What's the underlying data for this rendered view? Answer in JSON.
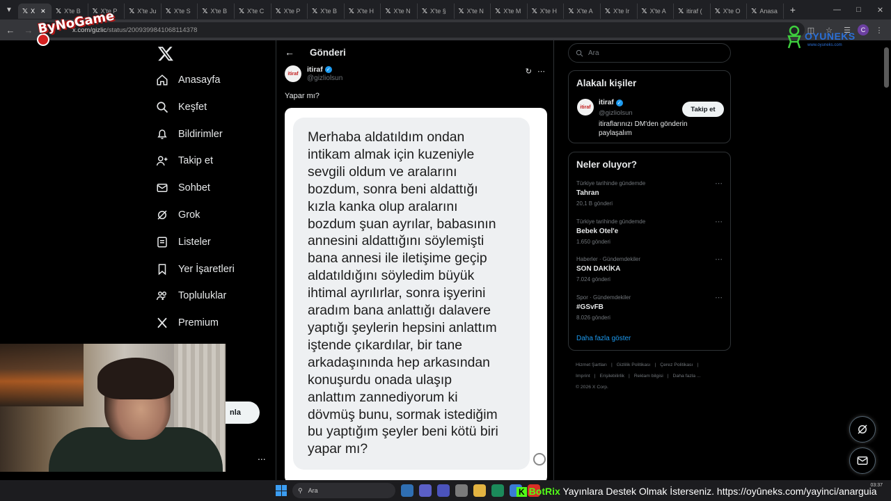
{
  "browser": {
    "tabs": [
      {
        "label": "X",
        "active": true
      },
      {
        "label": "X'te B"
      },
      {
        "label": "X'te P"
      },
      {
        "label": "X'te Ju"
      },
      {
        "label": "X'te S"
      },
      {
        "label": "X'te B"
      },
      {
        "label": "X'te C"
      },
      {
        "label": "X'te P"
      },
      {
        "label": "X'te B"
      },
      {
        "label": "X'te H"
      },
      {
        "label": "X'te N"
      },
      {
        "label": "X'te §"
      },
      {
        "label": "X'te N"
      },
      {
        "label": "X'te M"
      },
      {
        "label": "X'te H"
      },
      {
        "label": "X'te A"
      },
      {
        "label": "X'te Ir"
      },
      {
        "label": "X'te A"
      },
      {
        "label": "itiraf ("
      },
      {
        "label": "X'te O"
      },
      {
        "label": "Anasa"
      }
    ],
    "url_host": "x.com/gizlic",
    "url_path": "/status/2009399841068114378",
    "profile_initial": "C"
  },
  "overlay": {
    "brand": "ByNoGame",
    "sponsor": "OYUNEKS",
    "sponsor_url": "www.oyuneks.com"
  },
  "nav": {
    "items": [
      {
        "label": "Anasayfa",
        "icon": "home-icon"
      },
      {
        "label": "Keşfet",
        "icon": "search-icon"
      },
      {
        "label": "Bildirimler",
        "icon": "bell-icon"
      },
      {
        "label": "Takip et",
        "icon": "follow-icon"
      },
      {
        "label": "Sohbet",
        "icon": "mail-icon"
      },
      {
        "label": "Grok",
        "icon": "grok-icon"
      },
      {
        "label": "Listeler",
        "icon": "list-icon"
      },
      {
        "label": "Yer İşaretleri",
        "icon": "bookmark-icon"
      },
      {
        "label": "Topluluklar",
        "icon": "community-icon"
      },
      {
        "label": "Premium",
        "icon": "x-premium-icon"
      }
    ],
    "post_button": "nla",
    "more": "..."
  },
  "post": {
    "header_title": "Gönderi",
    "author_name": "itiraf",
    "author_handle": "@gizliolsun",
    "avatar_text": "itiraf",
    "text": "Yapar mı?",
    "image_lines": [
      "Merhaba aldatıldım ondan",
      "intikam almak için kuzeniyle",
      "sevgili oldum ve aralarını",
      "bozdum, sonra beni aldattığı",
      "kızla kanka olup aralarını",
      "bozdum şuan ayrılar, babasının",
      "annesini aldattığını söylemişti",
      "bana annesi ile iletişime geçip",
      "aldatıldığını söyledim büyük",
      "ihtimal ayrılırlar, sonra işyerini",
      "aradım bana anlattığı dalavere",
      "yaptığı şeylerin hepsini anlattım",
      "iştende çıkardılar, bir tane",
      "arkadaşınında hep arkasından",
      "konuşurdu onada ulaşıp",
      "anlattım zannediyorum ki",
      "dövmüş bunu, sormak istediğim",
      "bu yaptığım şeyler beni kötü biri",
      "yapar mı?"
    ]
  },
  "right": {
    "search_placeholder": "Ara",
    "related": {
      "title": "Alakalı kişiler",
      "name": "itiraf",
      "handle": "@gizliolsun",
      "bio": "itiraflarınızı DM'den gönderin paylaşalım",
      "follow_label": "Takip et"
    },
    "trends_title": "Neler oluyor?",
    "trends": [
      {
        "context": "Türkiye tarihinde gündemde",
        "name": "Tahran",
        "count": "20,1 B gönderi"
      },
      {
        "context": "Türkiye tarihinde gündemde",
        "name": "Bebek Otel'e",
        "count": "1.650 gönderi"
      },
      {
        "context": "Haberler · Gündemdekiler",
        "name": "SON DAKİKA",
        "count": "7.024 gönderi"
      },
      {
        "context": "Spor · Gündemdekiler",
        "name": "#GSvFB",
        "count": "8.026 gönderi"
      }
    ],
    "show_more": "Daha fazla göster",
    "footer": [
      "Hizmet Şartları",
      "|",
      "Gizlilik Politikası",
      "|",
      "Çerez Politikası",
      "|",
      "Imprint",
      "|",
      "Erişilebilirlik",
      "|",
      "Reklam bilgisi",
      "|",
      "Daha fazla ...",
      "© 2026 X Corp."
    ]
  },
  "taskbar": {
    "search": "Ara",
    "ticker_badge": "K",
    "ticker_bot": "BotRix",
    "ticker_text": "Yayınlara Destek Olmak İsterseniz. https://oyûneks.com/yayinci/anarguia",
    "time": "03:37"
  }
}
